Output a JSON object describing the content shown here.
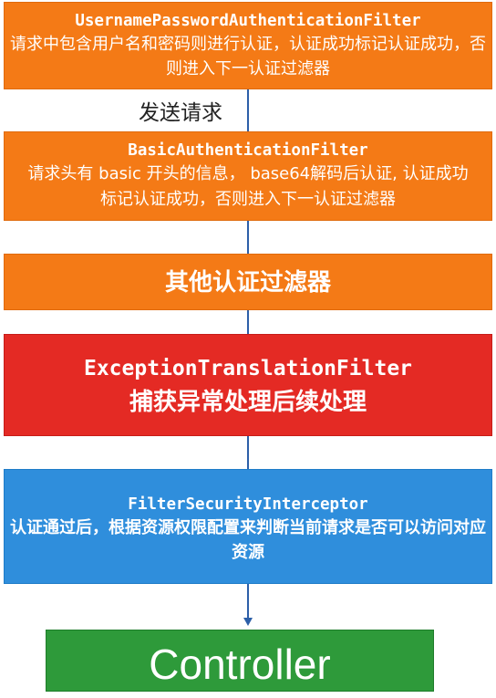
{
  "boxes": {
    "upaf": {
      "title": "UsernamePasswordAuthenticationFilter",
      "desc": "请求中包含用户名和密码则进行认证，认证成功标记认证成功，否则进入下一认证过滤器"
    },
    "send_label": "发送请求",
    "basic": {
      "title": "BasicAuthenticationFilter",
      "desc": "请求头有 basic 开头的信息， base64解码后认证, 认证成功标记认证成功，否则进入下一认证过滤器"
    },
    "other": {
      "title": "其他认证过滤器"
    },
    "etf": {
      "title": "ExceptionTranslationFilter",
      "desc": "捕获异常处理后续处理"
    },
    "fsi": {
      "title": "FilterSecurityInterceptor",
      "desc": "认证通过后，根据资源权限配置来判断当前请求是否可以访问对应资源"
    },
    "controller": {
      "title": "Controller"
    }
  },
  "colors": {
    "orange": "#f47a16",
    "red": "#e42a24",
    "blue": "#2f8edc",
    "green": "#2e9a3a",
    "line": "#2c5fa8"
  }
}
